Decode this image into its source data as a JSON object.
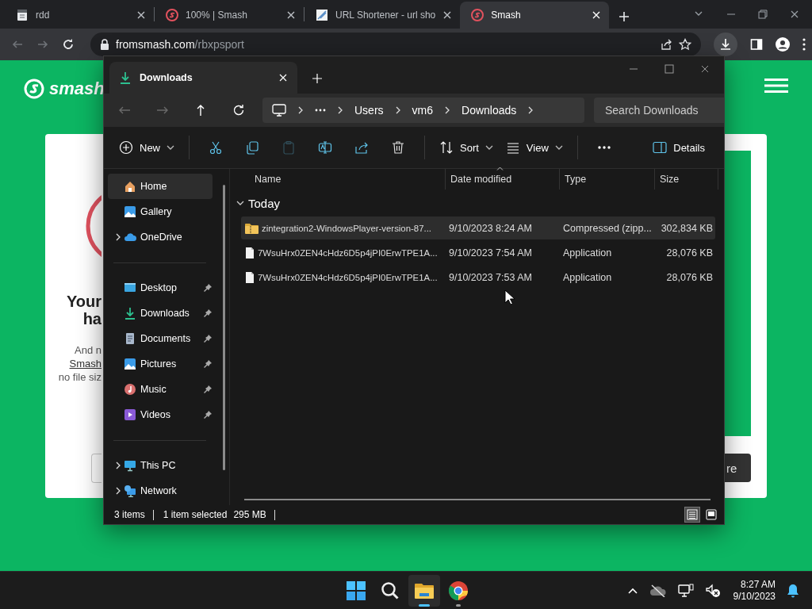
{
  "browser": {
    "tabs": [
      {
        "title": "rdd",
        "selected": false
      },
      {
        "title": "100% | Smash",
        "selected": false
      },
      {
        "title": "URL Shortener - url sho",
        "selected": false
      },
      {
        "title": "Smash",
        "selected": true
      }
    ],
    "nav": [
      {
        "disabled": true
      },
      {
        "disabled": true
      }
    ],
    "url_host": "fromsmash.com",
    "url_path": "/rbxpsport"
  },
  "web_page": {
    "logo": "smash",
    "heading": [
      "Your",
      "ha"
    ],
    "body": [
      {
        "text": "And n",
        "link": false
      },
      {
        "text": "Smash",
        "link": true
      },
      {
        "text": "no file siz",
        "link": false
      }
    ],
    "button": "re"
  },
  "explorer": {
    "tabs": [
      {
        "label": "Downloads",
        "selected": true
      }
    ],
    "nav": [
      {
        "disabled": true
      },
      {
        "disabled": true
      },
      {
        "disabled": false
      },
      {
        "disabled": false
      }
    ],
    "breadcrumb": [
      "Users",
      "vm6",
      "Downloads"
    ],
    "search": {
      "placeholder": "Search Downloads"
    },
    "commands": [
      {
        "kind": "menu",
        "label": "New"
      },
      {
        "kind": "divider"
      },
      {
        "kind": "tool",
        "disabled": false
      },
      {
        "kind": "tool",
        "disabled": false
      },
      {
        "kind": "tool",
        "disabled": true
      },
      {
        "kind": "tool",
        "disabled": false
      },
      {
        "kind": "tool",
        "disabled": false
      },
      {
        "kind": "tool",
        "disabled": false
      },
      {
        "kind": "divider"
      },
      {
        "kind": "menu",
        "label": "Sort"
      },
      {
        "kind": "menu",
        "label": "View"
      },
      {
        "kind": "divider"
      },
      {
        "kind": "more"
      },
      {
        "kind": "pane",
        "label": "Details"
      }
    ],
    "sidebar": {
      "sections": [
        {
          "items": [
            {
              "label": "Home",
              "selected": true
            },
            {
              "label": "Gallery",
              "selected": false
            },
            {
              "label": "OneDrive",
              "selected": false,
              "expanded": false
            }
          ]
        },
        {
          "items": [
            {
              "label": "Desktop",
              "selected": false,
              "pinned": true
            },
            {
              "label": "Downloads",
              "selected": false,
              "pinned": true
            },
            {
              "label": "Documents",
              "selected": false,
              "pinned": true
            },
            {
              "label": "Pictures",
              "selected": false,
              "pinned": true
            },
            {
              "label": "Music",
              "selected": false,
              "pinned": true
            },
            {
              "label": "Videos",
              "selected": false,
              "pinned": true
            }
          ]
        },
        {
          "items": [
            {
              "label": "This PC",
              "selected": false,
              "expanded": false
            },
            {
              "label": "Network",
              "selected": false,
              "expanded": false
            }
          ]
        }
      ]
    },
    "columns": [
      {
        "label": "Name",
        "sorted": false
      },
      {
        "label": "Date modified",
        "sorted": true
      },
      {
        "label": "Type",
        "sorted": false
      },
      {
        "label": "Size",
        "sorted": false
      }
    ],
    "group": {
      "label": "Today",
      "expanded": true
    },
    "rows": [
      {
        "kind": "zip",
        "name": "zintegration2-WindowsPlayer-version-87...",
        "date": "9/10/2023 8:24 AM",
        "type": "Compressed (zipp...",
        "size": "302,834 KB",
        "selected": true
      },
      {
        "kind": "file",
        "name": "7WsuHrx0ZEN4cHdz6D5p4jPI0ErwTPE1A...",
        "date": "9/10/2023 7:54 AM",
        "type": "Application",
        "size": "28,076 KB",
        "selected": false
      },
      {
        "kind": "file",
        "name": "7WsuHrx0ZEN4cHdz6D5p4jPI0ErwTPE1A...",
        "date": "9/10/2023 7:53 AM",
        "type": "Application",
        "size": "28,076 KB",
        "selected": false
      }
    ],
    "status": {
      "count": "3 items",
      "selection": "1 item selected",
      "size": "295 MB"
    },
    "view_modes": [
      {
        "selected": true
      },
      {
        "selected": false
      }
    ]
  },
  "taskbar": {
    "apps": [
      {
        "active": false,
        "running": false
      },
      {
        "active": false,
        "running": false
      },
      {
        "active": true,
        "running": true
      },
      {
        "active": false,
        "running": true
      }
    ],
    "time": "8:27 AM",
    "date": "9/10/2023"
  }
}
